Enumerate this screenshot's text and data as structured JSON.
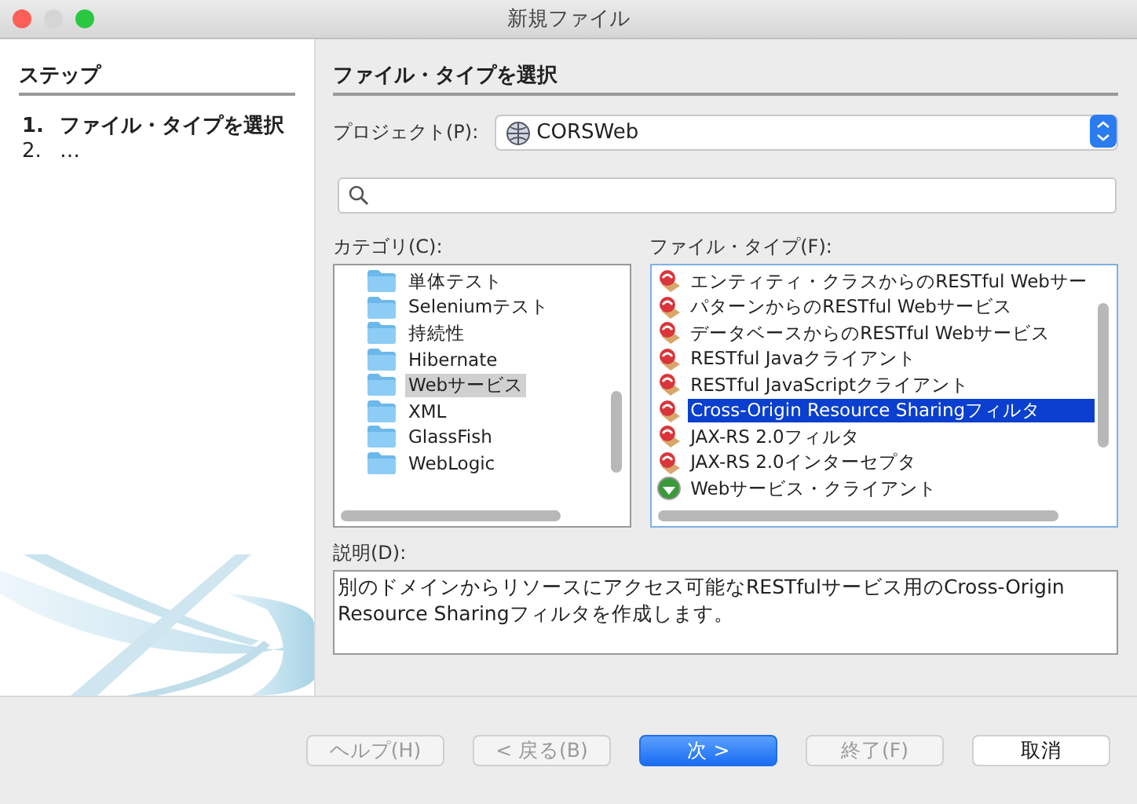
{
  "window": {
    "title": "新規ファイル"
  },
  "steps": {
    "heading": "ステップ",
    "items": [
      {
        "number": "1.",
        "label": "ファイル・タイプを選択",
        "selected": true
      },
      {
        "number": "2.",
        "label": "…",
        "selected": false
      }
    ]
  },
  "heading": "ファイル・タイプを選択",
  "project": {
    "label": "プロジェクト(P):",
    "value": "CORSWeb"
  },
  "categories": {
    "label": "カテゴリ(C):",
    "items": [
      {
        "label": "単体テスト",
        "selected": false
      },
      {
        "label": "Seleniumテスト",
        "selected": false
      },
      {
        "label": "持続性",
        "selected": false
      },
      {
        "label": "Hibernate",
        "selected": false
      },
      {
        "label": "Webサービス",
        "selected": true
      },
      {
        "label": "XML",
        "selected": false
      },
      {
        "label": "GlassFish",
        "selected": false
      },
      {
        "label": "WebLogic",
        "selected": false
      }
    ]
  },
  "file_types": {
    "label": "ファイル・タイプ(F):",
    "items": [
      {
        "label": "エンティティ・クラスからのRESTful Webサー",
        "kind": "rest",
        "selected": false
      },
      {
        "label": "パターンからのRESTful Webサービス",
        "kind": "rest",
        "selected": false
      },
      {
        "label": "データベースからのRESTful Webサービス",
        "kind": "rest",
        "selected": false
      },
      {
        "label": "RESTful Javaクライアント",
        "kind": "rest",
        "selected": false
      },
      {
        "label": "RESTful JavaScriptクライアント",
        "kind": "rest",
        "selected": false
      },
      {
        "label": "Cross-Origin Resource Sharingフィルタ",
        "kind": "rest",
        "selected": true
      },
      {
        "label": "JAX-RS 2.0フィルタ",
        "kind": "rest",
        "selected": false
      },
      {
        "label": "JAX-RS 2.0インターセプタ",
        "kind": "rest",
        "selected": false
      },
      {
        "label": "Webサービス・クライアント",
        "kind": "client",
        "selected": false
      }
    ]
  },
  "description": {
    "label": "説明(D):",
    "text": "別のドメインからリソースにアクセス可能なRESTfulサービス用のCross-Origin Resource Sharingフィルタを作成します。"
  },
  "buttons": [
    {
      "label": "ヘルプ(H)",
      "disabled": true,
      "primary": false
    },
    {
      "label": "< 戻る(B)",
      "disabled": true,
      "primary": false
    },
    {
      "label": "次 >",
      "disabled": false,
      "primary": true
    },
    {
      "label": "終了(F)",
      "disabled": true,
      "primary": false
    },
    {
      "label": "取消",
      "disabled": false,
      "primary": false
    }
  ]
}
